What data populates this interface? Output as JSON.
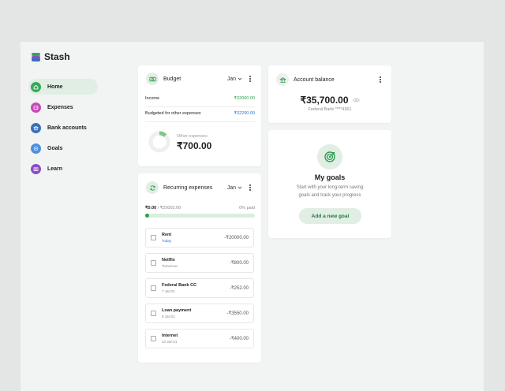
{
  "app": {
    "name": "Stash"
  },
  "colors": {
    "accent": "#2d9d4e",
    "link": "#2f6fd6"
  },
  "sidebar": {
    "items": [
      {
        "label": "Home",
        "icon": "home-icon",
        "color": "#37a859",
        "active": true
      },
      {
        "label": "Expenses",
        "icon": "wallet-icon",
        "color": "#c84bb8",
        "active": false
      },
      {
        "label": "Bank accounts",
        "icon": "bank-icon",
        "color": "#3b6fb8",
        "active": false
      },
      {
        "label": "Goals",
        "icon": "target-icon",
        "color": "#4d8fe0",
        "active": false
      },
      {
        "label": "Learn",
        "icon": "book-icon",
        "color": "#8a4ec5",
        "active": false
      }
    ]
  },
  "budget": {
    "title": "Budget",
    "month": "Jan",
    "income_label": "Income",
    "income_value": "₹32000.00",
    "budgeted_label": "Budgeted for other expenses",
    "budgeted_value": "₹32200.00",
    "other_label": "Other expenses",
    "other_value": "₹700.00",
    "donut_fraction": 0.12
  },
  "recurring": {
    "title": "Recurring expenses",
    "month": "Jan",
    "paid": "₹0.00",
    "total": "/ ₹25002.00",
    "percent_label": "0% paid",
    "progress": 0.0,
    "items": [
      {
        "name": "Rent",
        "date": "Today",
        "amount": "-₹20000.00",
        "today": true
      },
      {
        "name": "Netflix",
        "date": "Tomorrow",
        "amount": "-₹800.00",
        "today": false
      },
      {
        "name": "Federal Bank CC",
        "date": "7 Jan'21",
        "amount": "-₹252.00",
        "today": false
      },
      {
        "name": "Loan payment",
        "date": "8 Jan'21",
        "amount": "-₹3550.00",
        "today": false
      },
      {
        "name": "Internet",
        "date": "10 Jan'21",
        "amount": "-₹400.00",
        "today": false
      }
    ]
  },
  "account": {
    "title": "Account balance",
    "balance": "₹35,700.00",
    "bank": "Federal Bank ****4361"
  },
  "goals": {
    "title": "My goals",
    "desc_line1": "Start with your long-term saving",
    "desc_line2": "goals and track your progress",
    "button": "Add a new goal"
  }
}
